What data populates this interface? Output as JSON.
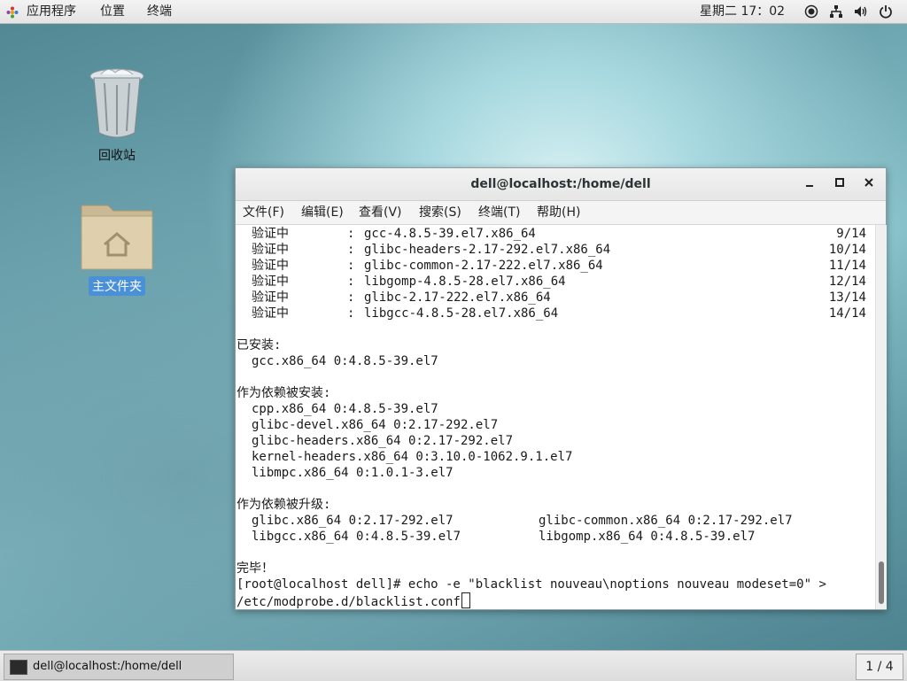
{
  "topbar": {
    "apps_label": "应用程序",
    "places_label": "位置",
    "terminal_label": "终端",
    "clock": "星期二 17：02"
  },
  "desktop": {
    "trash_label": "回收站",
    "home_label": "主文件夹"
  },
  "window": {
    "title": "dell@localhost:/home/dell",
    "menu": [
      "文件(F)",
      "编辑(E)",
      "查看(V)",
      "搜索(S)",
      "终端(T)",
      "帮助(H)"
    ]
  },
  "terminal": {
    "verify_rows": [
      {
        "label": "验证中",
        "pkg": "gcc-4.8.5-39.el7.x86_64",
        "count": "9/14"
      },
      {
        "label": "验证中",
        "pkg": "glibc-headers-2.17-292.el7.x86_64",
        "count": "10/14"
      },
      {
        "label": "验证中",
        "pkg": "glibc-common-2.17-222.el7.x86_64",
        "count": "11/14"
      },
      {
        "label": "验证中",
        "pkg": "libgomp-4.8.5-28.el7.x86_64",
        "count": "12/14"
      },
      {
        "label": "验证中",
        "pkg": "glibc-2.17-222.el7.x86_64",
        "count": "13/14"
      },
      {
        "label": "验证中",
        "pkg": "libgcc-4.8.5-28.el7.x86_64",
        "count": "14/14"
      }
    ],
    "installed_header": "已安装:",
    "installed": [
      "gcc.x86_64 0:4.8.5-39.el7"
    ],
    "deps_header": "作为依赖被安装:",
    "deps": [
      "cpp.x86_64 0:4.8.5-39.el7",
      "glibc-devel.x86_64 0:2.17-292.el7",
      "glibc-headers.x86_64 0:2.17-292.el7",
      "kernel-headers.x86_64 0:3.10.0-1062.9.1.el7",
      "libmpc.x86_64 0:1.0.1-3.el7"
    ],
    "upgraded_header": "作为依赖被升级:",
    "upgraded_left": [
      "glibc.x86_64 0:2.17-292.el7",
      "libgcc.x86_64 0:4.8.5-39.el7"
    ],
    "upgraded_right": [
      "glibc-common.x86_64 0:2.17-292.el7",
      "libgomp.x86_64 0:4.8.5-39.el7"
    ],
    "done": "完毕！",
    "prompt_line1": "[root@localhost dell]# echo -e \"blacklist nouveau\\noptions nouveau modeset=0\" >",
    "prompt_line2": "/etc/modprobe.d/blacklist.conf"
  },
  "bottombar": {
    "task_label": "dell@localhost:/home/dell",
    "workspace": "1 / 4"
  }
}
